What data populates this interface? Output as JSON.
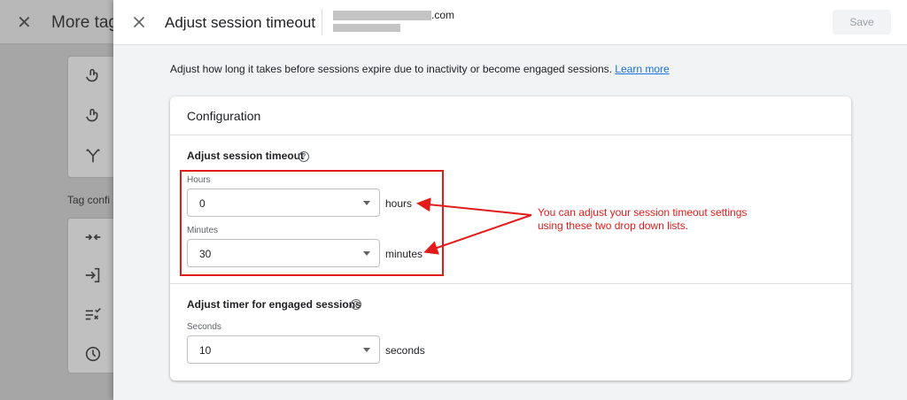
{
  "background_panel": {
    "title": "More tagg",
    "section_label": "Tag confi",
    "icons": [
      "touch-icon",
      "touch-icon",
      "fork-icon",
      "collapse-icon",
      "login-icon",
      "checklist-icon",
      "clock-icon"
    ]
  },
  "header": {
    "title": "Adjust session timeout",
    "domain_suffix": ".com",
    "save_label": "Save"
  },
  "description": {
    "text": "Adjust how long it takes before sessions expire due to inactivity or become engaged sessions.",
    "link": "Learn more"
  },
  "card": {
    "title": "Configuration",
    "timeout_section": {
      "title": "Adjust session timeout",
      "hours": {
        "label": "Hours",
        "value": "0",
        "unit": "hours"
      },
      "minutes": {
        "label": "Minutes",
        "value": "30",
        "unit": "minutes"
      }
    },
    "engaged_section": {
      "title": "Adjust timer for engaged sessions",
      "seconds": {
        "label": "Seconds",
        "value": "10",
        "unit": "seconds"
      }
    }
  },
  "annotation": {
    "line1": "You can adjust your session timeout settings",
    "line2": "using these two drop down lists.",
    "color": "#e31b1b"
  },
  "colors": {
    "link": "#1a73e8",
    "overlay_bg": "#f1f3f4"
  }
}
